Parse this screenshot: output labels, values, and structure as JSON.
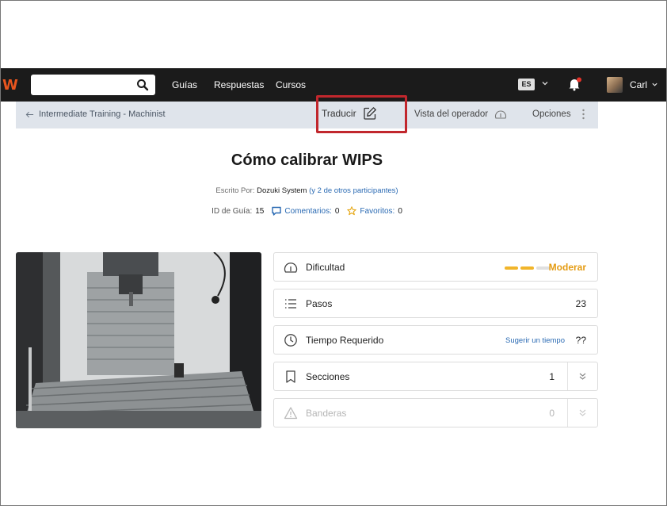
{
  "nav": {
    "logo": "W",
    "links": [
      "Guías",
      "Respuestas",
      "Cursos"
    ],
    "lang": "ES",
    "user": "Carl"
  },
  "toolbar": {
    "back_label": "Intermediate Training - Machinist",
    "translate_label": "Traducir",
    "operator_label": "Vista del operador",
    "options_label": "Opciones"
  },
  "guide": {
    "title": "Cómo calibrar WIPS",
    "byline_prefix": "Escrito Por:",
    "author": "Dozuki System",
    "others": "(y 2 de otros participantes)",
    "id_label": "ID de Guía:",
    "id_value": "15",
    "comments_label": "Comentarios:",
    "comments_value": "0",
    "favorites_label": "Favoritos:",
    "favorites_value": "0"
  },
  "details": {
    "difficulty": {
      "label": "Dificultad",
      "value": "Moderar",
      "level": 2,
      "max": 3
    },
    "steps": {
      "label": "Pasos",
      "value": "23"
    },
    "time": {
      "label": "Tiempo Requerido",
      "suggest": "Sugerir un tiempo",
      "value": "??"
    },
    "sections": {
      "label": "Secciones",
      "value": "1"
    },
    "flags": {
      "label": "Banderas",
      "value": "0"
    }
  },
  "colors": {
    "nav_bg": "#1b1b1b",
    "highlight": "#c1272d",
    "accent_orange": "#f1b52a",
    "link_blue": "#2a6ab3"
  }
}
